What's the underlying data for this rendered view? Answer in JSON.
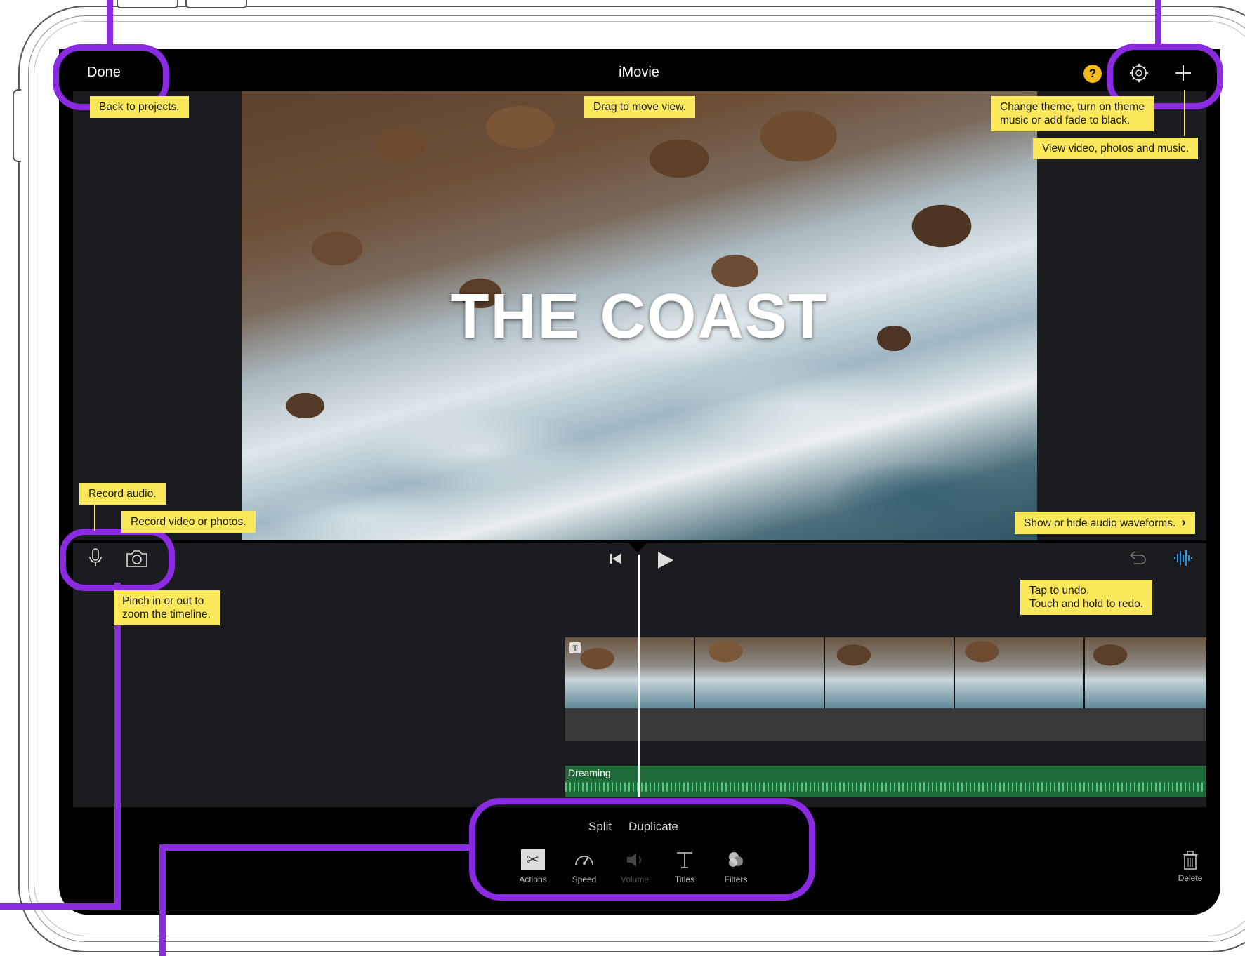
{
  "header": {
    "title": "iMovie",
    "done_label": "Done",
    "help_label": "?"
  },
  "viewer": {
    "title_text": "THE COAST"
  },
  "timeline": {
    "audio_clip_name": "Dreaming",
    "clip_title_badge": "T"
  },
  "toolbar": {
    "split_label": "Split",
    "duplicate_label": "Duplicate",
    "tools": [
      {
        "label": "Actions",
        "icon": "scissors-icon"
      },
      {
        "label": "Speed",
        "icon": "speedometer-icon"
      },
      {
        "label": "Volume",
        "icon": "speaker-icon"
      },
      {
        "label": "Titles",
        "icon": "text-t-icon"
      },
      {
        "label": "Filters",
        "icon": "filter-circles-icon"
      }
    ],
    "delete_label": "Delete"
  },
  "tips": {
    "back": "Back to projects.",
    "drag": "Drag to move view.",
    "theme_line1": "Change theme, turn on theme",
    "theme_line2": "music or add fade to black.",
    "media": "View video, photos and music.",
    "record_audio": "Record audio.",
    "record_video": "Record video or photos.",
    "waveforms": "Show or hide audio waveforms.",
    "pinch_line1": "Pinch in or out to",
    "pinch_line2": "zoom the timeline.",
    "undo_line1": "Tap to undo.",
    "undo_line2": "Touch and hold to redo."
  },
  "colors": {
    "callout": "#8a2be2",
    "tip_bg": "#fbe85a",
    "audio_track": "#1f6b3a",
    "help_badge": "#f5b91c"
  }
}
